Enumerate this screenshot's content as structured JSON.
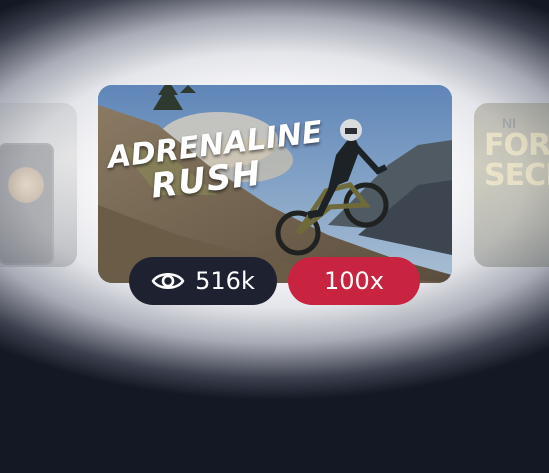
{
  "carousel": {
    "main_card": {
      "headline_line1": "ADRENALINE",
      "headline_line2": "RUSH"
    },
    "right_card": {
      "top_text": "NI",
      "title_text": "FORT\nSECI"
    },
    "views": {
      "icon": "eye-icon",
      "count": "516k"
    },
    "multiplier": {
      "label": "100x"
    }
  },
  "colors": {
    "background": "#141824",
    "views_pill": "#1e2230",
    "multiplier_pill": "#c8243f"
  }
}
